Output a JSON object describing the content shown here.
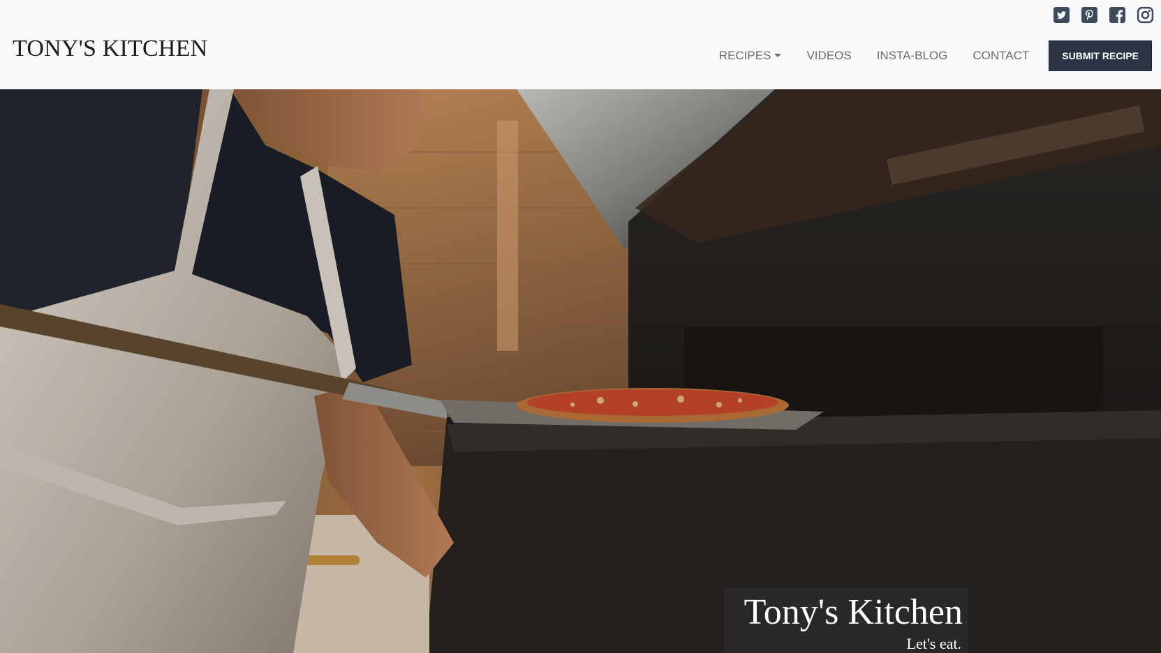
{
  "header": {
    "brand": "TONY'S KITCHEN"
  },
  "social": {
    "icons": [
      "twitter-icon",
      "pinterest-icon",
      "facebook-icon",
      "instagram-icon"
    ],
    "icon_color": "#3d4a5c"
  },
  "nav": {
    "recipes": "RECIPES",
    "videos": "VIDEOS",
    "insta_blog": "INSTA-BLOG",
    "contact": "CONTACT",
    "submit": "SUBMIT RECIPE"
  },
  "hero": {
    "title": "Tony's Kitchen",
    "subtitle": "Let's eat."
  },
  "colors": {
    "page_bg": "#f8f9fa",
    "button_bg": "#2b3446",
    "nav_text": "#6c6c6c"
  }
}
